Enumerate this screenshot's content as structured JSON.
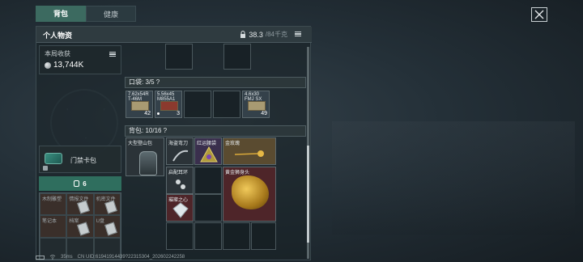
{
  "tabs": [
    {
      "label": "背包",
      "active": true
    },
    {
      "label": "健康",
      "active": false
    }
  ],
  "panel": {
    "title": "个人物资",
    "weight_current": "38.3",
    "weight_max": "/84千克"
  },
  "income": {
    "label": "本局收获",
    "value": "13,744K"
  },
  "keycard": {
    "name": "门禁卡包"
  },
  "stash": {
    "count": "6",
    "cells": [
      {
        "label": "木制雕塑",
        "filled": true
      },
      {
        "label": "情报文件",
        "filled": true
      },
      {
        "label": "机密文件",
        "filled": true
      },
      {
        "label": "笔记本",
        "filled": true
      },
      {
        "label": "档案",
        "filled": true
      },
      {
        "label": "U盘",
        "filled": true
      },
      {
        "label": "",
        "filled": false
      },
      {
        "label": "",
        "filled": false
      },
      {
        "label": "",
        "filled": false
      }
    ]
  },
  "pocket": {
    "label": "口袋: 3/5 ?",
    "ammo": [
      {
        "name": "7.62x54R\nT-46M",
        "count": "42"
      },
      {
        "name": "5.56x45\nM855A1",
        "count": "3"
      },
      {
        "name": "4.6x30\nFMJ SX",
        "count": "49"
      }
    ]
  },
  "backpack": {
    "label": "背包: 10/16 ?",
    "items": [
      {
        "name": "大型登山包",
        "rarity": "gray"
      },
      {
        "name": "海盗弯刀",
        "rarity": "gray"
      },
      {
        "name": "红运腰袋",
        "rarity": "purple"
      },
      {
        "name": "金玫瑰",
        "rarity": "gold"
      },
      {
        "name": "启配耳环",
        "rarity": "gray"
      },
      {
        "name": "黄金狮身头",
        "rarity": "red"
      },
      {
        "name": "璀璨之心",
        "rarity": "red"
      }
    ]
  },
  "status_bar": {
    "ping": "35ms",
    "uid": "CN UID:61941914439?22315304_202602242258"
  },
  "colors": {
    "accent_green": "#2f6e5e",
    "gold_rarity": "#5a4b30",
    "purple_rarity": "#3a2f4d",
    "red_rarity": "#4e2529"
  },
  "icons": [
    "lock-icon",
    "list-icon",
    "close-icon",
    "coin-icon",
    "backpack-icon",
    "wifi-icon",
    "battery-icon"
  ]
}
